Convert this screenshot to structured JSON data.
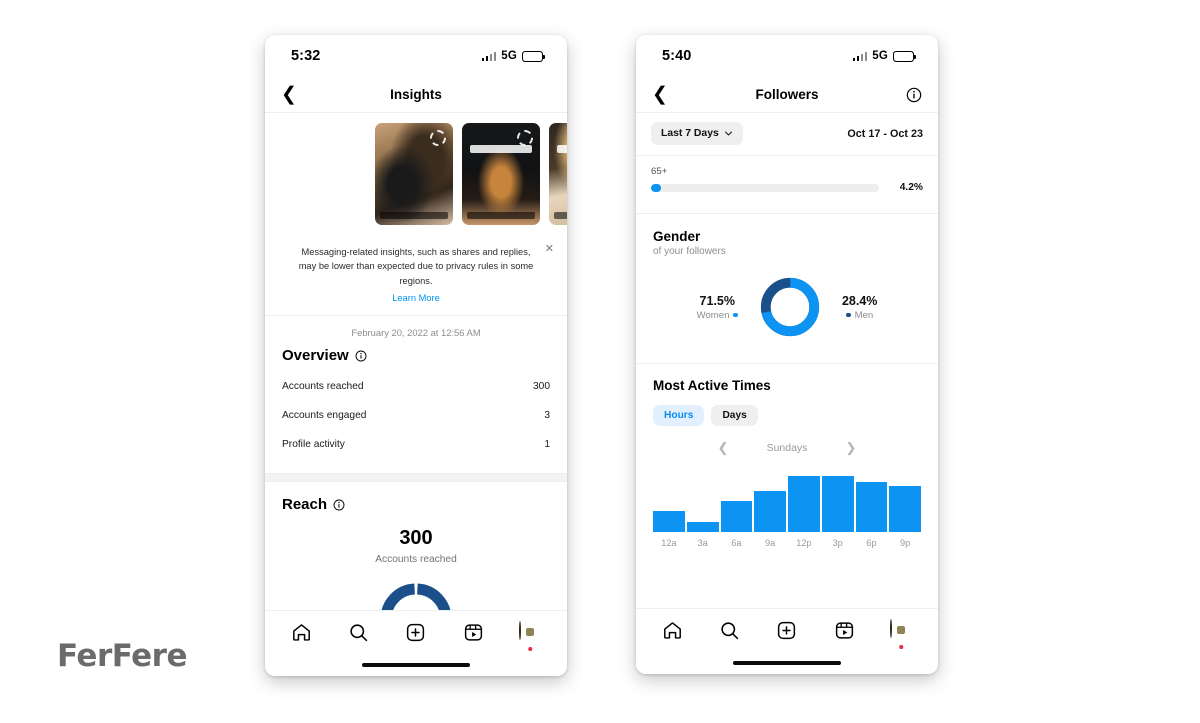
{
  "colors": {
    "brand_blue": "#0a94f0",
    "link_blue": "#0095f6",
    "seg_active_bg": "#e2f0fd",
    "seg_active_text": "#0a8cf0",
    "bar_blue": "#0d93f2",
    "gauge_navy": "#1b4f8a",
    "notification_red": "#ed2f45",
    "avatar_yellow": "#f2ce1b",
    "logo_gray": "#6b6b6b"
  },
  "watermark": {
    "text": "FerFere"
  },
  "left_phone": {
    "status_bar": {
      "time": "5:32",
      "network": "5G",
      "signal_icon": "signal-bars-icon",
      "battery_icon": "battery-icon"
    },
    "header": {
      "back_icon": "chevron-left-icon",
      "title": "Insights"
    },
    "stories": [
      {
        "name": "story-thumb-1",
        "caption": "ramen bowl story"
      },
      {
        "name": "story-thumb-2",
        "caption": "dark ramen story"
      },
      {
        "name": "story-thumb-3",
        "caption": "text overlay story"
      }
    ],
    "notice": {
      "text": "Messaging-related insights, such as shares and replies, may be lower than expected due to privacy rules in some regions.",
      "link": "Learn More",
      "close_icon": "close-icon"
    },
    "timestamp": "February 20, 2022 at 12:56 AM",
    "overview": {
      "title": "Overview",
      "info_icon": "info-circle-icon",
      "rows": [
        {
          "label": "Accounts reached",
          "value": "300"
        },
        {
          "label": "Accounts engaged",
          "value": "3"
        },
        {
          "label": "Profile activity",
          "value": "1"
        }
      ]
    },
    "reach": {
      "title": "Reach",
      "info_icon": "info-circle-icon",
      "big_value": "300",
      "sub_label": "Accounts reached"
    },
    "tabbar": {
      "items": [
        {
          "name": "tab-home",
          "icon": "home-icon"
        },
        {
          "name": "tab-search",
          "icon": "search-icon"
        },
        {
          "name": "tab-create",
          "icon": "plus-square-icon"
        },
        {
          "name": "tab-reels",
          "icon": "reels-icon"
        },
        {
          "name": "tab-profile",
          "icon": "avatar-icon"
        }
      ]
    }
  },
  "right_phone": {
    "status_bar": {
      "time": "5:40",
      "network": "5G",
      "signal_icon": "signal-bars-icon",
      "battery_icon": "battery-icon"
    },
    "header": {
      "back_icon": "chevron-left-icon",
      "title": "Followers",
      "info_icon": "info-circle-icon"
    },
    "filter": {
      "range_label": "Last 7 Days",
      "chevron_icon": "chevron-down-icon",
      "date_range": "Oct 17 - Oct 23"
    },
    "age_bar": {
      "label": "65+",
      "percent_label": "4.2%",
      "percent_value": 4.2
    },
    "gender": {
      "title": "Gender",
      "subtitle": "of your followers",
      "women_pct": "71.5%",
      "women_label": "Women",
      "men_pct": "28.4%",
      "men_label": "Men"
    },
    "most_active": {
      "title": "Most Active Times",
      "segments": [
        {
          "label": "Hours",
          "active": true
        },
        {
          "label": "Days",
          "active": false
        }
      ],
      "prev_icon": "chevron-left-icon",
      "next_icon": "chevron-right-icon",
      "day_label": "Sundays"
    },
    "tabbar": {
      "items": [
        {
          "name": "tab-home",
          "icon": "home-icon"
        },
        {
          "name": "tab-search",
          "icon": "search-icon"
        },
        {
          "name": "tab-create",
          "icon": "plus-square-icon"
        },
        {
          "name": "tab-reels",
          "icon": "reels-icon"
        },
        {
          "name": "tab-profile",
          "icon": "avatar-icon"
        }
      ]
    }
  },
  "chart_data": [
    {
      "type": "pie",
      "title": "Gender",
      "subtitle": "of your followers",
      "labels": [
        "Women",
        "Men"
      ],
      "values": [
        71.5,
        28.4
      ],
      "colors": [
        "#0d93f2",
        "#1b4f8a"
      ],
      "donut": true,
      "legend": "sides"
    },
    {
      "type": "bar",
      "title": "Most Active Times",
      "subtitle": "Sundays",
      "categories": [
        "12a",
        "3a",
        "6a",
        "9a",
        "12p",
        "3p",
        "6p",
        "9p"
      ],
      "values": [
        27,
        13,
        40,
        53,
        72,
        72,
        64,
        60
      ],
      "ylim": [
        0,
        80
      ],
      "xlabel": "",
      "ylabel": "",
      "grid": false,
      "color": "#0d93f2"
    },
    {
      "type": "bar",
      "title": "Age range 65+",
      "categories": [
        "65+"
      ],
      "values": [
        4.2
      ],
      "ylim": [
        0,
        100
      ],
      "orientation": "horizontal",
      "color": "#0a94f0"
    }
  ]
}
